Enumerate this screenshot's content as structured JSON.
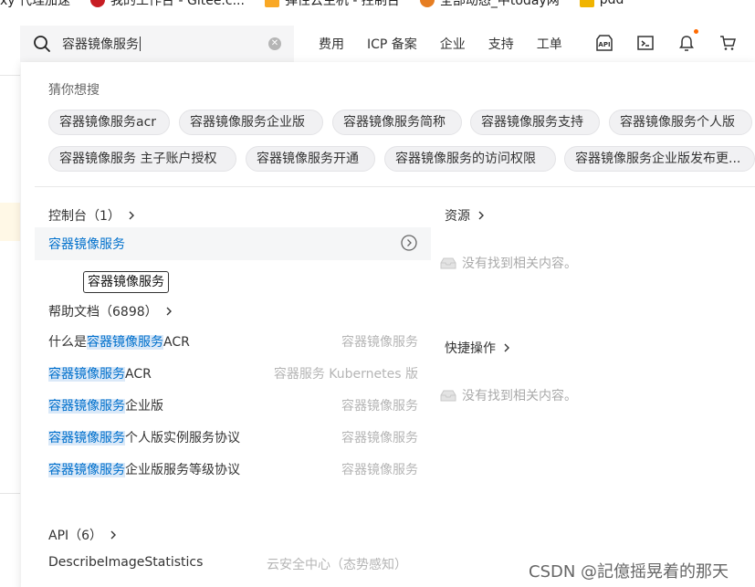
{
  "bookmarks": [
    {
      "label": "xy 代理加速",
      "color": "#9aa0a6"
    },
    {
      "label": "我的工作台 - Gitee.c...",
      "color": "#c71d23"
    },
    {
      "label": "弹性云主机 - 控制台",
      "color": "#f9a825"
    },
    {
      "label": "全部动态_中today网",
      "color": "#e67e22"
    },
    {
      "label": "pdd",
      "color": "#f0b400"
    }
  ],
  "search": {
    "value": "容器镜像服务"
  },
  "nav": {
    "links": [
      "费用",
      "ICP 备案",
      "企业",
      "支持",
      "工单"
    ],
    "icons": [
      "api-icon",
      "terminal-icon",
      "bell-icon",
      "cart-icon"
    ]
  },
  "guess": {
    "label": "猜你想搜",
    "chips": [
      "容器镜像服务acr",
      "容器镜像服务企业版",
      "容器镜像服务简称",
      "容器镜像服务支持",
      "容器镜像服务个人版",
      "容器镜像服务 主子账户授权",
      "容器镜像服务开通",
      "容器镜像服务的访问权限",
      "容器镜像服务企业版发布更..."
    ]
  },
  "console": {
    "title": "控制台（1）",
    "item": "容器镜像服务",
    "tooltip": "容器镜像服务"
  },
  "resources": {
    "title": "资源",
    "empty": "没有找到相关内容。"
  },
  "quick": {
    "title": "快捷操作",
    "empty": "没有找到相关内容。"
  },
  "docs": {
    "title": "帮助文档（6898）",
    "items": [
      {
        "pre": "什么是",
        "hit": "容器镜像服务",
        "post": "ACR",
        "category": "容器镜像服务"
      },
      {
        "pre": "",
        "hit": "容器镜像服务",
        "post": "ACR",
        "category": "容器服务 Kubernetes 版"
      },
      {
        "pre": "",
        "hit": "容器镜像服务",
        "post": "企业版",
        "category": "容器镜像服务"
      },
      {
        "pre": "",
        "hit": "容器镜像服务",
        "post": "个人版实例服务协议",
        "category": "容器镜像服务"
      },
      {
        "pre": "",
        "hit": "容器镜像服务",
        "post": "企业版服务等级协议",
        "category": "容器镜像服务"
      }
    ]
  },
  "api": {
    "title": "API（6）",
    "item": "DescribeImageStatistics",
    "category": "云安全中心（态势感知）"
  },
  "watermark": "CSDN @記億摇晃着的那天",
  "colors": {
    "accent": "#0070cc",
    "notify": "#ff6a00"
  }
}
